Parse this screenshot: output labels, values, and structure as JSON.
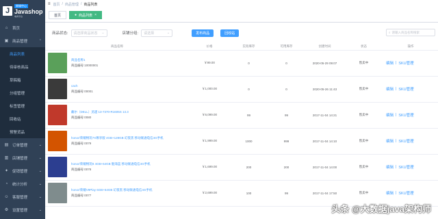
{
  "app": {
    "logo_sub": "商城中心",
    "logo_main": "Javashop",
    "logo_tag": "电商平台"
  },
  "sidebar": {
    "items": [
      {
        "label": "首页",
        "icon": "home-icon"
      },
      {
        "label": "商品管理",
        "icon": "goods-icon",
        "expanded": true
      },
      {
        "label": "订单管理",
        "icon": "order-icon"
      },
      {
        "label": "店铺管理",
        "icon": "shop-icon"
      },
      {
        "label": "促销管理",
        "icon": "promotion-icon"
      },
      {
        "label": "统计分析",
        "icon": "stats-icon"
      },
      {
        "label": "客服管理",
        "icon": "service-icon"
      },
      {
        "label": "设置管理",
        "icon": "settings-icon"
      }
    ],
    "sub_items": [
      "商品列表",
      "待审核商品",
      "草稿箱",
      "分组管理",
      "标签管理",
      "回收站",
      "预警货品"
    ]
  },
  "topbar": {
    "breadcrumbs": [
      "首页",
      "商品管理",
      "商品列表"
    ]
  },
  "tags": {
    "home": "首页",
    "current": "商品列表",
    "close": "×"
  },
  "filters": {
    "status_label": "商品状态:",
    "status_placeholder": "请选择商品状态",
    "group_label": "店铺分组:",
    "group_placeholder": "请选择",
    "publish_button": "发布商品",
    "recycle_button": "回收站",
    "search_placeholder": "请输入商品名称搜索"
  },
  "table": {
    "headers": [
      "商品名称",
      "价格",
      "实际库存",
      "可用库存",
      "创建时间",
      "状态",
      "操作"
    ],
    "rows": [
      {
        "name": "商品名称1",
        "code": "商品编号:10000001",
        "price": "￥99.00",
        "stock": "0",
        "available": "0",
        "created": "2020-05-29 09:07",
        "status": "售卖中",
        "thumb_color": "#5aa05a"
      },
      {
        "name": "cach",
        "code": "商品编号:00001",
        "price": "￥1,000.00",
        "stock": "0",
        "available": "0",
        "created": "2020-05-26 11:43",
        "status": "售卖中",
        "thumb_color": "#3a3a3a"
      },
      {
        "name": "戴尔（DELL）灵越 13-7370-R1605S 13.3",
        "code": "商品编号:0080",
        "price": "￥6,099.00",
        "stock": "99",
        "available": "99",
        "created": "2017-11-04 14:21",
        "status": "售卖中",
        "thumb_color": "#c0392b"
      },
      {
        "name": "honor/荣耀畅玩7X尊享版 4GB+128GB 幻夜黑 移动联通电信4G手机",
        "code": "商品编号:0079",
        "price": "￥1,999.00",
        "stock": "1000",
        "available": "999",
        "created": "2017-11-04 14:10",
        "status": "售卖中",
        "thumb_color": "#d35400"
      },
      {
        "name": "honor/荣耀畅玩8 4GB+64GB 魅海蓝 移动联通电信4G手机",
        "code": "商品编号:0078",
        "price": "￥1,699.00",
        "stock": "200",
        "available": "200",
        "created": "2017-11-04 14:00",
        "status": "售卖中",
        "thumb_color": "#2c3e90"
      },
      {
        "name": "honor/荣耀V9Play 6GB+64GB 幻夜黑 移动联通电信4G手机",
        "code": "商品编号:0077",
        "price": "￥2,699.00",
        "stock": "100",
        "available": "99",
        "created": "2017-11-04 17:50",
        "status": "售卖中",
        "thumb_color": "#7f8c8d"
      }
    ],
    "ops": {
      "edit": "编辑",
      "sku": "SKU管理",
      "sep": "|"
    }
  },
  "watermark": "头条 @大数据java架构师"
}
